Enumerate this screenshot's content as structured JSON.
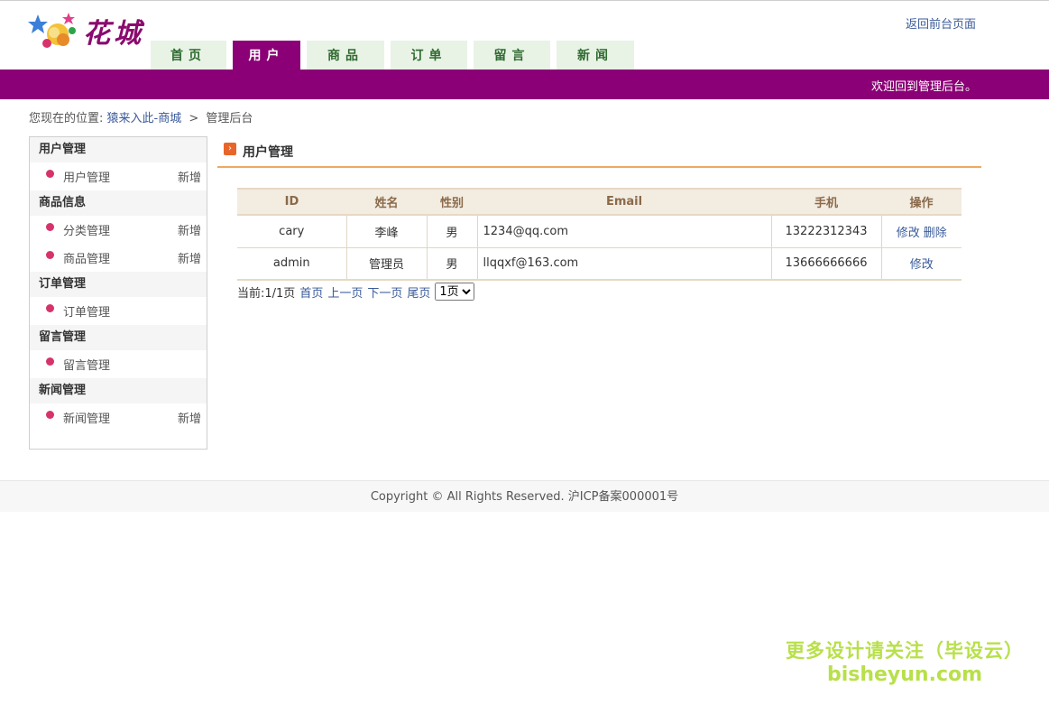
{
  "header": {
    "logo_text": "花城",
    "back_link": "返回前台页面",
    "welcome": "欢迎回到管理后台。"
  },
  "nav": {
    "tabs": [
      {
        "label": "首页",
        "width": 84
      },
      {
        "label": "用户",
        "width": 75
      },
      {
        "label": "商品",
        "width": 86
      },
      {
        "label": "订单",
        "width": 85
      },
      {
        "label": "留言",
        "width": 85
      },
      {
        "label": "新闻",
        "width": 86
      }
    ],
    "active_index": 1
  },
  "breadcrumb": {
    "prefix": "您现在的位置:",
    "link": "猿来入此-商城",
    "sep": ">",
    "current": "管理后台"
  },
  "sidebar": {
    "groups": [
      {
        "title": "用户管理",
        "items": [
          {
            "label": "用户管理",
            "add": "新增"
          }
        ]
      },
      {
        "title": "商品信息",
        "items": [
          {
            "label": "分类管理",
            "add": "新增"
          },
          {
            "label": "商品管理",
            "add": "新增"
          }
        ]
      },
      {
        "title": "订单管理",
        "items": [
          {
            "label": "订单管理",
            "add": ""
          }
        ]
      },
      {
        "title": "留言管理",
        "items": [
          {
            "label": "留言管理",
            "add": ""
          }
        ]
      },
      {
        "title": "新闻管理",
        "items": [
          {
            "label": "新闻管理",
            "add": "新增"
          }
        ]
      }
    ]
  },
  "main": {
    "title": "用户管理",
    "columns": [
      "ID",
      "姓名",
      "性别",
      "Email",
      "手机",
      "操作"
    ],
    "rows": [
      {
        "id": "cary",
        "name": "李峰",
        "gender": "男",
        "email": "1234@qq.com",
        "phone": "13222312343",
        "ops": [
          "修改",
          "删除"
        ]
      },
      {
        "id": "admin",
        "name": "管理员",
        "gender": "男",
        "email": "llqqxf@163.com",
        "phone": "13666666666",
        "ops": [
          "修改"
        ]
      }
    ]
  },
  "pager": {
    "status": "当前:1/1页",
    "first": "首页",
    "prev": "上一页",
    "next": "下一页",
    "last": "尾页",
    "select_value": "1页"
  },
  "footer": {
    "text": "Copyright © All Rights Reserved. 沪ICP备案000001号"
  },
  "watermark": {
    "line1": "更多设计请关注（毕设云）",
    "line2": "bisheyun.com"
  }
}
